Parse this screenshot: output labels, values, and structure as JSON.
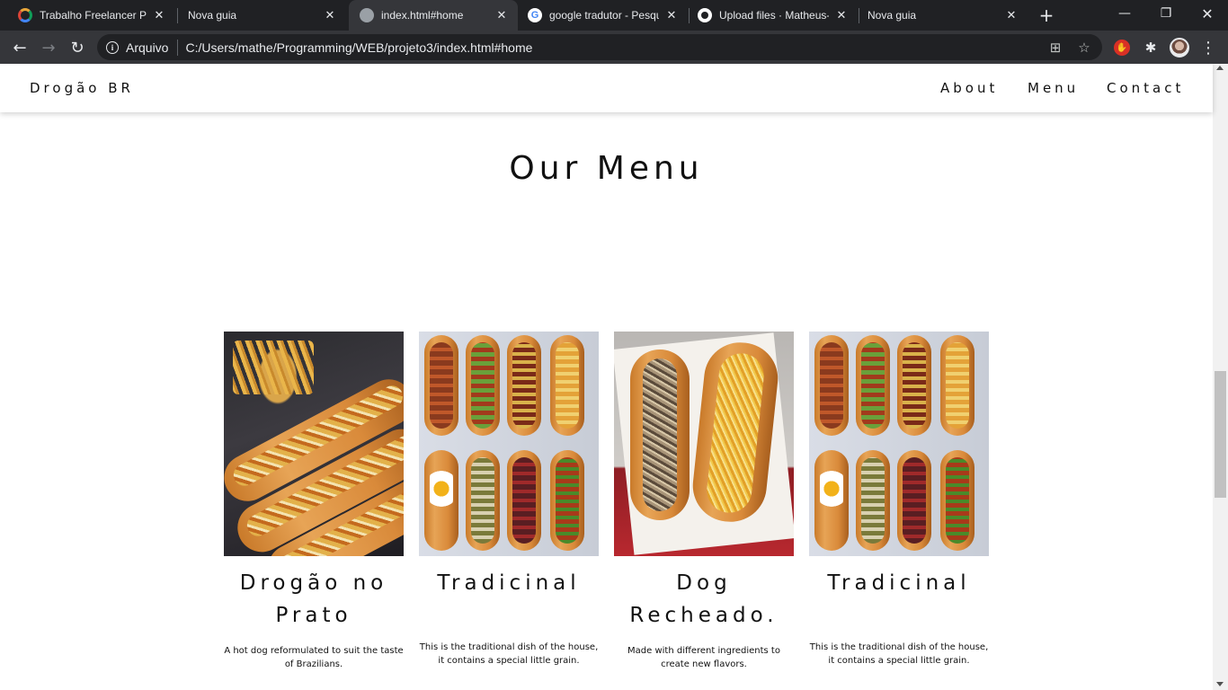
{
  "browser": {
    "tabs": [
      {
        "title": "Trabalho Freelancer Por",
        "favicon": "ring-icon",
        "active": false
      },
      {
        "title": "Nova guia",
        "favicon": "none",
        "active": false
      },
      {
        "title": "index.html#home",
        "favicon": "globe-icon",
        "active": true
      },
      {
        "title": "google tradutor - Pesqu",
        "favicon": "google-icon",
        "active": false
      },
      {
        "title": "Upload files · Matheus-",
        "favicon": "github-icon",
        "active": false
      },
      {
        "title": "Nova guia",
        "favicon": "none",
        "active": false
      }
    ],
    "address": {
      "chip": "Arquivo",
      "url": "C:/Users/mathe/Programming/WEB/projeto3/index.html#home"
    },
    "icons": {
      "back": "←",
      "forward": "→",
      "reload": "↻",
      "new_tab": "+",
      "minimize": "—",
      "restore": "❐",
      "close": "✕",
      "tab_close": "✕",
      "translate": "⊞",
      "star": "☆",
      "extensions": "✱",
      "menu": "⋮",
      "info": "i"
    }
  },
  "site": {
    "brand": "Drogão BR",
    "nav": [
      "About",
      "Menu",
      "Contact"
    ],
    "menu_title": "Our Menu",
    "items": [
      {
        "name": "Drogão no Prato",
        "description": "A hot dog reformulated to suit the taste of Brazilians."
      },
      {
        "name": "Tradicinal",
        "description": "This is the traditional dish of the house, it contains a special little grain."
      },
      {
        "name": "Dog Recheado.",
        "description": "Made with different ingredients to create new flavors."
      },
      {
        "name": "Tradicinal",
        "description": "This is the traditional dish of the house, it contains a special little grain."
      }
    ]
  }
}
